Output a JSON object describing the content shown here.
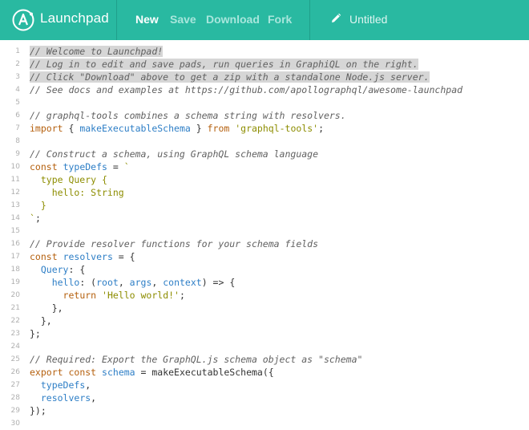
{
  "header": {
    "app_name": "Launchpad",
    "nav": {
      "new": "New",
      "save": "Save",
      "download": "Download",
      "fork": "Fork"
    },
    "title": "Untitled"
  },
  "editor": {
    "lines": [
      {
        "n": "1",
        "parts": [
          {
            "t": "// Welcome to Launchpad!",
            "c": "comment",
            "sel": true
          }
        ]
      },
      {
        "n": "2",
        "parts": [
          {
            "t": "// Log in to edit and save pads, run queries in GraphiQL on the right.",
            "c": "comment",
            "sel": true
          }
        ]
      },
      {
        "n": "3",
        "parts": [
          {
            "t": "// Click \"Download\" above to get a zip with a standalone Node.js server.",
            "c": "comment",
            "sel": true
          }
        ]
      },
      {
        "n": "4",
        "parts": [
          {
            "t": "// See docs and examples at https://github.com/apollographql/awesome-launchpad",
            "c": "comment"
          }
        ]
      },
      {
        "n": "5",
        "parts": []
      },
      {
        "n": "6",
        "parts": [
          {
            "t": "// graphql-tools combines a schema string with resolvers.",
            "c": "comment"
          }
        ]
      },
      {
        "n": "7",
        "parts": [
          {
            "t": "import",
            "c": "kw"
          },
          {
            "t": " { ",
            "c": "plain"
          },
          {
            "t": "makeExecutableSchema",
            "c": "var"
          },
          {
            "t": " } ",
            "c": "plain"
          },
          {
            "t": "from",
            "c": "kw"
          },
          {
            "t": " ",
            "c": "plain"
          },
          {
            "t": "'graphql-tools'",
            "c": "str"
          },
          {
            "t": ";",
            "c": "plain"
          }
        ]
      },
      {
        "n": "8",
        "parts": []
      },
      {
        "n": "9",
        "parts": [
          {
            "t": "// Construct a schema, using GraphQL schema language",
            "c": "comment"
          }
        ]
      },
      {
        "n": "10",
        "parts": [
          {
            "t": "const",
            "c": "kw"
          },
          {
            "t": " ",
            "c": "plain"
          },
          {
            "t": "typeDefs",
            "c": "var"
          },
          {
            "t": " = ",
            "c": "plain"
          },
          {
            "t": "`",
            "c": "str"
          }
        ]
      },
      {
        "n": "11",
        "parts": [
          {
            "t": "  type Query {",
            "c": "str"
          }
        ]
      },
      {
        "n": "12",
        "parts": [
          {
            "t": "    hello: String",
            "c": "str"
          }
        ]
      },
      {
        "n": "13",
        "parts": [
          {
            "t": "  }",
            "c": "str"
          }
        ]
      },
      {
        "n": "14",
        "parts": [
          {
            "t": "`",
            "c": "str"
          },
          {
            "t": ";",
            "c": "plain"
          }
        ]
      },
      {
        "n": "15",
        "parts": []
      },
      {
        "n": "16",
        "parts": [
          {
            "t": "// Provide resolver functions for your schema fields",
            "c": "comment"
          }
        ]
      },
      {
        "n": "17",
        "parts": [
          {
            "t": "const",
            "c": "kw"
          },
          {
            "t": " ",
            "c": "plain"
          },
          {
            "t": "resolvers",
            "c": "var"
          },
          {
            "t": " = {",
            "c": "plain"
          }
        ]
      },
      {
        "n": "18",
        "parts": [
          {
            "t": "  ",
            "c": "plain"
          },
          {
            "t": "Query",
            "c": "var"
          },
          {
            "t": ": {",
            "c": "plain"
          }
        ]
      },
      {
        "n": "19",
        "parts": [
          {
            "t": "    ",
            "c": "plain"
          },
          {
            "t": "hello",
            "c": "var"
          },
          {
            "t": ": (",
            "c": "plain"
          },
          {
            "t": "root",
            "c": "var"
          },
          {
            "t": ", ",
            "c": "plain"
          },
          {
            "t": "args",
            "c": "var"
          },
          {
            "t": ", ",
            "c": "plain"
          },
          {
            "t": "context",
            "c": "var"
          },
          {
            "t": ") => {",
            "c": "plain"
          }
        ]
      },
      {
        "n": "20",
        "parts": [
          {
            "t": "      ",
            "c": "plain"
          },
          {
            "t": "return",
            "c": "kw"
          },
          {
            "t": " ",
            "c": "plain"
          },
          {
            "t": "'Hello world!'",
            "c": "str"
          },
          {
            "t": ";",
            "c": "plain"
          }
        ]
      },
      {
        "n": "21",
        "parts": [
          {
            "t": "    },",
            "c": "plain"
          }
        ]
      },
      {
        "n": "22",
        "parts": [
          {
            "t": "  },",
            "c": "plain"
          }
        ]
      },
      {
        "n": "23",
        "parts": [
          {
            "t": "};",
            "c": "plain"
          }
        ]
      },
      {
        "n": "24",
        "parts": []
      },
      {
        "n": "25",
        "parts": [
          {
            "t": "// Required: Export the GraphQL.js schema object as \"schema\"",
            "c": "comment"
          }
        ]
      },
      {
        "n": "26",
        "parts": [
          {
            "t": "export",
            "c": "kw"
          },
          {
            "t": " ",
            "c": "plain"
          },
          {
            "t": "const",
            "c": "kw"
          },
          {
            "t": " ",
            "c": "plain"
          },
          {
            "t": "schema",
            "c": "var"
          },
          {
            "t": " = makeExecutableSchema({",
            "c": "plain"
          }
        ]
      },
      {
        "n": "27",
        "parts": [
          {
            "t": "  ",
            "c": "plain"
          },
          {
            "t": "typeDefs",
            "c": "var"
          },
          {
            "t": ",",
            "c": "plain"
          }
        ]
      },
      {
        "n": "28",
        "parts": [
          {
            "t": "  ",
            "c": "plain"
          },
          {
            "t": "resolvers",
            "c": "var"
          },
          {
            "t": ",",
            "c": "plain"
          }
        ]
      },
      {
        "n": "29",
        "parts": [
          {
            "t": "});",
            "c": "plain"
          }
        ]
      },
      {
        "n": "30",
        "parts": []
      }
    ]
  },
  "colors": {
    "header_bg": "#29b9a1",
    "comment": "#616161",
    "keyword": "#b5600e",
    "string": "#8d8d00",
    "variable": "#2d7ec6",
    "selection": "#d6d6d6"
  },
  "icons": [
    "launchpad-logo-icon",
    "pencil-icon"
  ]
}
